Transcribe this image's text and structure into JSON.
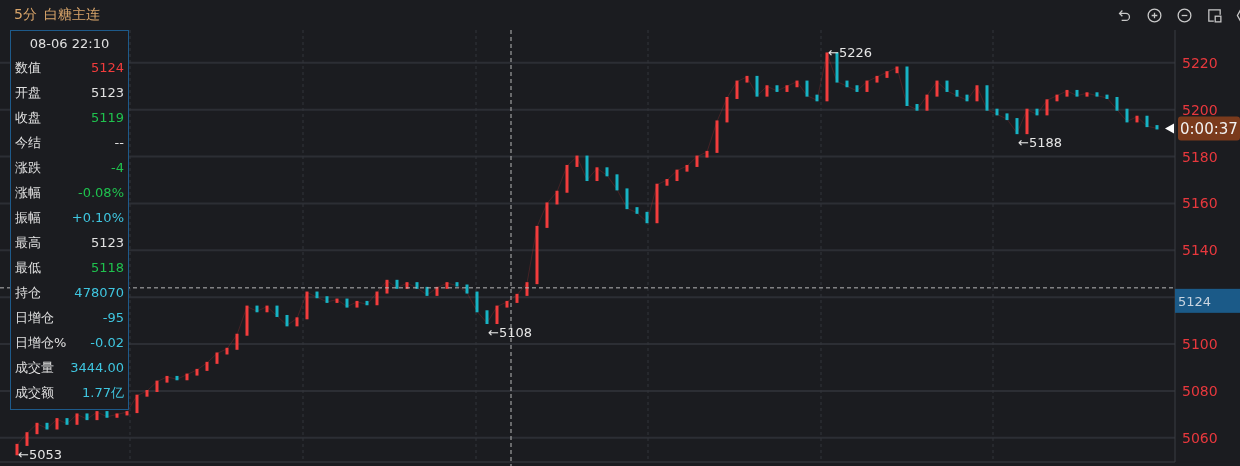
{
  "header": {
    "period": "5分",
    "symbol": "白糖主连"
  },
  "info_panel": {
    "time": "08-06 22:10",
    "rows": [
      {
        "label": "数值",
        "value": "5124",
        "color": "#f23c3c"
      },
      {
        "label": "开盘",
        "value": "5123",
        "color": "#e0e0e0"
      },
      {
        "label": "收盘",
        "value": "5119",
        "color": "#1fc24e"
      },
      {
        "label": "今结",
        "value": "--",
        "color": "#e0e0e0"
      },
      {
        "label": "涨跌",
        "value": "-4",
        "color": "#1fc24e"
      },
      {
        "label": "涨幅",
        "value": "-0.08%",
        "color": "#1fc24e"
      },
      {
        "label": "振幅",
        "value": "+0.10%",
        "color": "#3fc6e0"
      },
      {
        "label": "最高",
        "value": "5123",
        "color": "#e0e0e0"
      },
      {
        "label": "最低",
        "value": "5118",
        "color": "#1fc24e"
      },
      {
        "label": "持仓",
        "value": "478070",
        "color": "#3fc6e0"
      },
      {
        "label": "日增仓",
        "value": "-95",
        "color": "#3fc6e0"
      },
      {
        "label": "日增仓%",
        "value": "-0.02",
        "color": "#3fc6e0"
      },
      {
        "label": "成交量",
        "value": "3444.00",
        "color": "#3fc6e0"
      },
      {
        "label": "成交额",
        "value": "1.77亿",
        "color": "#3fc6e0"
      }
    ]
  },
  "countdown": "0:00:37",
  "chart_data": {
    "type": "line",
    "grid": true,
    "ylim": [
      5048,
      5234
    ],
    "yticks": [
      5060,
      5080,
      5100,
      5140,
      5160,
      5180,
      5200,
      5220
    ],
    "series": [
      {
        "color": "#f23c3c",
        "values": [
          5057,
          5062,
          5066,
          5064,
          5068,
          5066,
          5070,
          5068,
          5071,
          5069,
          5070,
          5071,
          5078,
          5080,
          5084,
          5086,
          5085,
          5087,
          5089,
          5092,
          5096,
          5098,
          5104,
          5116,
          5114,
          5116,
          5112,
          5108,
          5111,
          5122,
          5120,
          5118,
          5119,
          5116,
          5118,
          5117,
          5122,
          5127,
          5124,
          5126,
          5124,
          5121,
          5124,
          5126,
          5125,
          5122,
          5114,
          5109,
          5116,
          5118,
          5121,
          5126,
          5150,
          5160,
          5165,
          5176,
          5180,
          5170,
          5175,
          5172,
          5166,
          5158,
          5156,
          5152,
          5168,
          5170,
          5174,
          5176,
          5180,
          5182,
          5195,
          5205,
          5212,
          5214,
          5206,
          5210,
          5208,
          5210,
          5212,
          5206,
          5204,
          5224,
          5212,
          5210,
          5208,
          5212,
          5214,
          5216,
          5218,
          5202,
          5200,
          5206,
          5212,
          5208,
          5206,
          5204,
          5210,
          5200,
          5198,
          5196,
          5190,
          5200,
          5198,
          5204,
          5206,
          5208,
          5206,
          5207,
          5206,
          5205,
          5200,
          5195,
          5197,
          5193,
          5192
        ]
      }
    ],
    "annotations": [
      "←5053",
      "←5108",
      "←5226",
      "←5188"
    ],
    "ref_lines": [
      {
        "axis": "y",
        "value": 5124,
        "label": "5124"
      }
    ]
  }
}
